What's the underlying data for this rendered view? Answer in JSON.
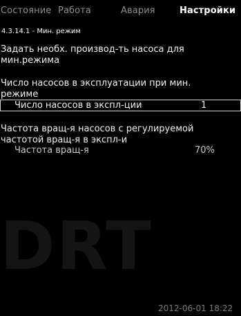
{
  "tabs": [
    {
      "label": "Состояние",
      "active": false
    },
    {
      "label": "Работа",
      "active": false
    },
    {
      "label": "Авария",
      "active": false
    },
    {
      "label": "Настройки",
      "active": true
    }
  ],
  "breadcrumb": "4.3.14.1 - Мин. режим",
  "description_lines": [
    "Задать необх. производ-ть насоса для",
    "мин.режима"
  ],
  "group1": {
    "heading_lines": [
      "Число насосов в эксплуатации при мин.",
      "режиме"
    ],
    "field": {
      "label": "Число насосов в экспл-ции",
      "value": "1"
    }
  },
  "group2": {
    "heading_lines": [
      "Частота вращ-я насосов с регулируемой",
      "частотой вращ-я в экспл-и"
    ],
    "field": {
      "label": "Частота вращ-я",
      "value": "70%"
    }
  },
  "watermark": "DRT",
  "datetime": "2012-06-01 18:22"
}
